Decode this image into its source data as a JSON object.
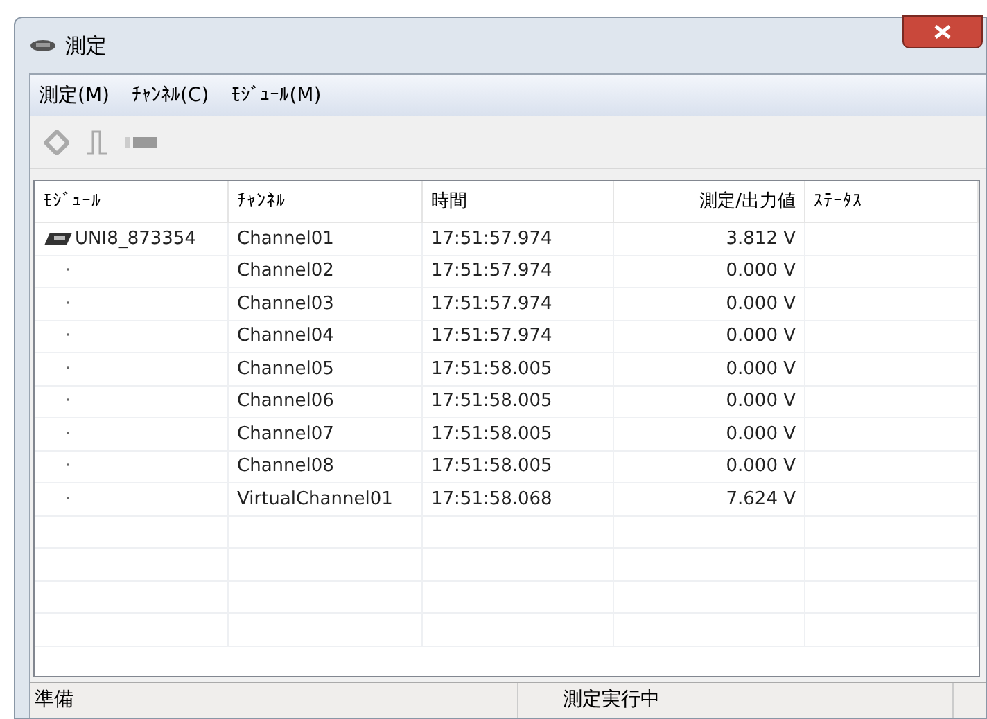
{
  "window": {
    "title": "測定"
  },
  "menu": [
    {
      "label": "測定(M)"
    },
    {
      "label": "ﾁｬﾝﾈﾙ(C)"
    },
    {
      "label": "ﾓｼﾞｭｰﾙ(M)"
    }
  ],
  "table": {
    "columns": [
      "ﾓｼﾞｭｰﾙ",
      "ﾁｬﾝﾈﾙ",
      "時間",
      "測定/出力値",
      "ｽﾃｰﾀｽ"
    ],
    "rows": [
      {
        "module": "UNI8_873354",
        "kind": "module",
        "channel": "Channel01",
        "time": "17:51:57.974",
        "value": "3.812 V"
      },
      {
        "module": "·",
        "kind": "child",
        "channel": "Channel02",
        "time": "17:51:57.974",
        "value": "0.000 V"
      },
      {
        "module": "·",
        "kind": "child",
        "channel": "Channel03",
        "time": "17:51:57.974",
        "value": "0.000 V"
      },
      {
        "module": "·",
        "kind": "child",
        "channel": "Channel04",
        "time": "17:51:57.974",
        "value": "0.000 V"
      },
      {
        "module": "·",
        "kind": "child",
        "channel": "Channel05",
        "time": "17:51:58.005",
        "value": "0.000 V"
      },
      {
        "module": "·",
        "kind": "child",
        "channel": "Channel06",
        "time": "17:51:58.005",
        "value": "0.000 V"
      },
      {
        "module": "·",
        "kind": "child",
        "channel": "Channel07",
        "time": "17:51:58.005",
        "value": "0.000 V"
      },
      {
        "module": "·",
        "kind": "child",
        "channel": "Channel08",
        "time": "17:51:58.005",
        "value": "0.000 V"
      },
      {
        "module": "·",
        "kind": "child",
        "channel": "VirtualChannel01",
        "time": "17:51:58.068",
        "value": "7.624 V"
      }
    ]
  },
  "status_bar": [
    "準備",
    "測定実行中"
  ]
}
